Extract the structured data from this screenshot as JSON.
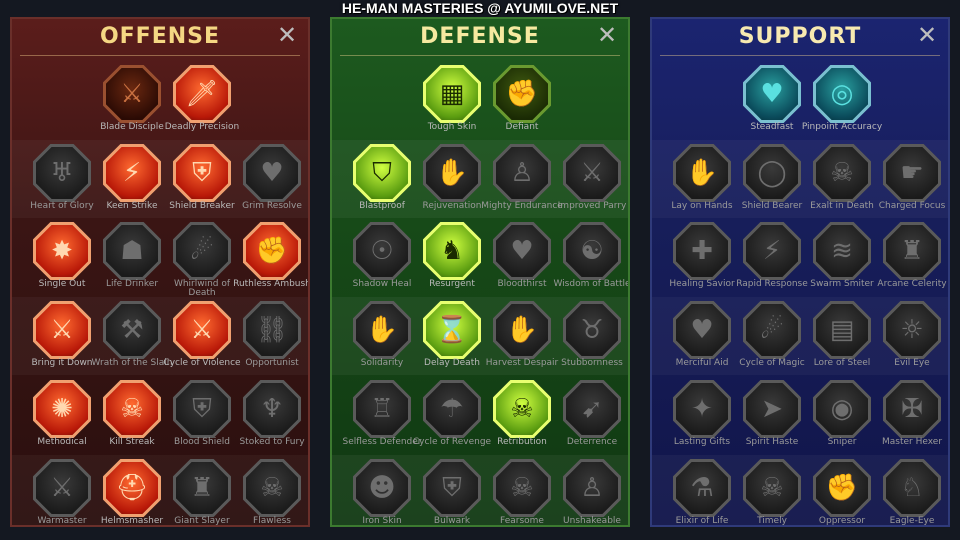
{
  "page_title": "HE-MAN MASTERIES @ AYUMILOVE.NET",
  "close_glyph": "✕",
  "panels": [
    {
      "id": "offense",
      "title": "OFFENSE",
      "skills": [
        {
          "label": "Blade Disciple",
          "icon": "crossed-swords-icon",
          "glyph": "⚔",
          "state": "dim-active",
          "row": 0,
          "col": 1
        },
        {
          "label": "Deadly Precision",
          "icon": "dagger-icon",
          "glyph": "🗡",
          "state": "active",
          "row": 0,
          "col": 2
        },
        {
          "label": "Heart of Glory",
          "icon": "horned-warrior-icon",
          "glyph": "♅",
          "state": "locked",
          "row": 1,
          "col": 0
        },
        {
          "label": "Keen Strike",
          "icon": "slash-icon",
          "glyph": "⚡",
          "state": "active",
          "row": 1,
          "col": 1
        },
        {
          "label": "Shield Breaker",
          "icon": "broken-shield-icon",
          "glyph": "⛨",
          "state": "active",
          "row": 1,
          "col": 2
        },
        {
          "label": "Grim Resolve",
          "icon": "heart-thorns-icon",
          "glyph": "♥",
          "state": "locked",
          "row": 1,
          "col": 3
        },
        {
          "label": "Single Out",
          "icon": "target-hit-icon",
          "glyph": "✸",
          "state": "active",
          "row": 2,
          "col": 0
        },
        {
          "label": "Life Drinker",
          "icon": "fangs-icon",
          "glyph": "☗",
          "state": "locked",
          "row": 2,
          "col": 1
        },
        {
          "label": "Whirlwind of Death",
          "icon": "whirlwind-icon",
          "glyph": "☄",
          "state": "locked",
          "row": 2,
          "col": 2
        },
        {
          "label": "Ruthless Ambush",
          "icon": "fist-blade-icon",
          "glyph": "✊",
          "state": "active",
          "row": 2,
          "col": 3
        },
        {
          "label": "Bring it Down",
          "icon": "falling-sword-icon",
          "glyph": "⚔",
          "state": "active",
          "row": 3,
          "col": 0
        },
        {
          "label": "Wrath of the Slain",
          "icon": "hammer-fist-icon",
          "glyph": "⚒",
          "state": "locked",
          "row": 3,
          "col": 1
        },
        {
          "label": "Cycle of Violence",
          "icon": "axe-icon",
          "glyph": "⚔",
          "state": "active",
          "row": 3,
          "col": 2
        },
        {
          "label": "Opportunist",
          "icon": "chain-lightning-icon",
          "glyph": "⛓",
          "state": "locked",
          "row": 3,
          "col": 3
        },
        {
          "label": "Methodical",
          "icon": "burst-circle-icon",
          "glyph": "✺",
          "state": "active",
          "row": 4,
          "col": 0
        },
        {
          "label": "Kill Streak",
          "icon": "skull-icon",
          "glyph": "☠",
          "state": "active",
          "row": 4,
          "col": 1
        },
        {
          "label": "Blood Shield",
          "icon": "sword-shield-icon",
          "glyph": "⛨",
          "state": "locked",
          "row": 4,
          "col": 2
        },
        {
          "label": "Stoked to Fury",
          "icon": "rage-figure-icon",
          "glyph": "♆",
          "state": "locked",
          "row": 4,
          "col": 3
        },
        {
          "label": "Warmaster",
          "icon": "warrior-sword-icon",
          "glyph": "⚔",
          "state": "locked",
          "row": 5,
          "col": 0
        },
        {
          "label": "Helmsmasher",
          "icon": "helmet-icon",
          "glyph": "⛑",
          "state": "active",
          "row": 5,
          "col": 1
        },
        {
          "label": "Giant Slayer",
          "icon": "giant-icon",
          "glyph": "♜",
          "state": "locked",
          "row": 5,
          "col": 2
        },
        {
          "label": "Flawless Execution",
          "icon": "skull-blade-icon",
          "glyph": "☠",
          "state": "locked",
          "row": 5,
          "col": 3
        }
      ]
    },
    {
      "id": "defense",
      "title": "DEFENSE",
      "skills": [
        {
          "label": "Tough Skin",
          "icon": "armor-plates-icon",
          "glyph": "▦",
          "state": "active",
          "row": 0,
          "col": 1
        },
        {
          "label": "Defiant",
          "icon": "raised-fist-icon",
          "glyph": "✊",
          "state": "dim-active",
          "row": 0,
          "col": 2
        },
        {
          "label": "Blastproof",
          "icon": "chevron-shield-icon",
          "glyph": "⛉",
          "state": "active",
          "row": 1,
          "col": 0
        },
        {
          "label": "Rejuvenation",
          "icon": "hand-heart-icon",
          "glyph": "✋",
          "state": "locked",
          "row": 1,
          "col": 1
        },
        {
          "label": "Mighty Endurance",
          "icon": "muscle-figure-icon",
          "glyph": "♙",
          "state": "locked",
          "row": 1,
          "col": 2
        },
        {
          "label": "Improved Parry",
          "icon": "parry-blades-icon",
          "glyph": "⚔",
          "state": "locked",
          "row": 1,
          "col": 3
        },
        {
          "label": "Shadow Heal",
          "icon": "shadow-figure-icon",
          "glyph": "☉",
          "state": "locked",
          "row": 2,
          "col": 0
        },
        {
          "label": "Resurgent",
          "icon": "knight-shield-icon",
          "glyph": "♞",
          "state": "active",
          "row": 2,
          "col": 1
        },
        {
          "label": "Bloodthirst",
          "icon": "skull-heart-icon",
          "glyph": "♥",
          "state": "locked",
          "row": 2,
          "col": 2
        },
        {
          "label": "Wisdom of Battle",
          "icon": "warrior-aura-icon",
          "glyph": "☯",
          "state": "locked",
          "row": 2,
          "col": 3
        },
        {
          "label": "Solidarity",
          "icon": "raised-hands-icon",
          "glyph": "✋",
          "state": "locked",
          "row": 3,
          "col": 0
        },
        {
          "label": "Delay Death",
          "icon": "hourglass-icon",
          "glyph": "⌛",
          "state": "active",
          "row": 3,
          "col": 1
        },
        {
          "label": "Harvest Despair",
          "icon": "open-hand-icon",
          "glyph": "✋",
          "state": "locked",
          "row": 3,
          "col": 2
        },
        {
          "label": "Stubbornness",
          "icon": "bull-head-icon",
          "glyph": "♉",
          "state": "locked",
          "row": 3,
          "col": 3
        },
        {
          "label": "Selfless Defender",
          "icon": "defender-figure-icon",
          "glyph": "♖",
          "state": "locked",
          "row": 4,
          "col": 0
        },
        {
          "label": "Cycle of Revenge",
          "icon": "drops-icon",
          "glyph": "☂",
          "state": "locked",
          "row": 4,
          "col": 1
        },
        {
          "label": "Retribution",
          "icon": "skull-burst-icon",
          "glyph": "☠",
          "state": "active",
          "row": 4,
          "col": 2
        },
        {
          "label": "Deterrence",
          "icon": "deflect-icon",
          "glyph": "➹",
          "state": "locked",
          "row": 4,
          "col": 3
        },
        {
          "label": "Iron Skin",
          "icon": "iron-face-icon",
          "glyph": "☻",
          "state": "locked",
          "row": 5,
          "col": 0
        },
        {
          "label": "Bulwark",
          "icon": "bulwark-shield-icon",
          "glyph": "⛨",
          "state": "locked",
          "row": 5,
          "col": 1
        },
        {
          "label": "Fearsome Presence",
          "icon": "demon-face-icon",
          "glyph": "☠",
          "state": "locked",
          "row": 5,
          "col": 2
        },
        {
          "label": "Unshakeable",
          "icon": "flexing-figure-icon",
          "glyph": "♙",
          "state": "locked",
          "row": 5,
          "col": 3
        }
      ]
    },
    {
      "id": "support",
      "title": "SUPPORT",
      "skills": [
        {
          "label": "Steadfast",
          "icon": "heart-hands-icon",
          "glyph": "♥",
          "state": "active",
          "row": 0,
          "col": 1
        },
        {
          "label": "Pinpoint Accuracy",
          "icon": "swirl-target-icon",
          "glyph": "◎",
          "state": "active",
          "row": 0,
          "col": 2
        },
        {
          "label": "Lay on Hands",
          "icon": "praying-hands-icon",
          "glyph": "✋",
          "state": "locked",
          "row": 1,
          "col": 0
        },
        {
          "label": "Shield Bearer",
          "icon": "round-shield-icon",
          "glyph": "◯",
          "state": "locked",
          "row": 1,
          "col": 1
        },
        {
          "label": "Exalt in Death",
          "icon": "burning-skull-icon",
          "glyph": "☠",
          "state": "locked",
          "row": 1,
          "col": 2
        },
        {
          "label": "Charged Focus",
          "icon": "charging-hand-icon",
          "glyph": "☛",
          "state": "locked",
          "row": 1,
          "col": 3
        },
        {
          "label": "Healing Savior",
          "icon": "healer-figure-icon",
          "glyph": "✚",
          "state": "locked",
          "row": 2,
          "col": 0
        },
        {
          "label": "Rapid Response",
          "icon": "lightning-shield-icon",
          "glyph": "⚡",
          "state": "locked",
          "row": 2,
          "col": 1
        },
        {
          "label": "Swarm Smiter",
          "icon": "swarm-icon",
          "glyph": "≋",
          "state": "locked",
          "row": 2,
          "col": 2
        },
        {
          "label": "Arcane Celerity",
          "icon": "running-figures-icon",
          "glyph": "♜",
          "state": "locked",
          "row": 2,
          "col": 3
        },
        {
          "label": "Merciful Aid",
          "icon": "chained-heart-icon",
          "glyph": "♥",
          "state": "locked",
          "row": 3,
          "col": 0
        },
        {
          "label": "Cycle of Magic",
          "icon": "comet-icon",
          "glyph": "☄",
          "state": "locked",
          "row": 3,
          "col": 1
        },
        {
          "label": "Lore of Steel",
          "icon": "open-book-icon",
          "glyph": "▤",
          "state": "locked",
          "row": 3,
          "col": 2
        },
        {
          "label": "Evil Eye",
          "icon": "eye-rays-icon",
          "glyph": "☼",
          "state": "locked",
          "row": 3,
          "col": 3
        },
        {
          "label": "Lasting Gifts",
          "icon": "compass-star-icon",
          "glyph": "✦",
          "state": "locked",
          "row": 4,
          "col": 0
        },
        {
          "label": "Spirit Haste",
          "icon": "boot-icon",
          "glyph": "➤",
          "state": "locked",
          "row": 4,
          "col": 1
        },
        {
          "label": "Sniper",
          "icon": "eye-icon",
          "glyph": "◉",
          "state": "locked",
          "row": 4,
          "col": 2
        },
        {
          "label": "Master Hexer",
          "icon": "hexer-figure-icon",
          "glyph": "✠",
          "state": "locked",
          "row": 4,
          "col": 3
        },
        {
          "label": "Elixir of Life",
          "icon": "potion-flask-icon",
          "glyph": "⚗",
          "state": "locked",
          "row": 5,
          "col": 0
        },
        {
          "label": "Timely Intervention",
          "icon": "skull-icon",
          "glyph": "☠",
          "state": "locked",
          "row": 5,
          "col": 1
        },
        {
          "label": "Oppressor",
          "icon": "gripping-hand-icon",
          "glyph": "✊",
          "state": "locked",
          "row": 5,
          "col": 2
        },
        {
          "label": "Eagle-Eye",
          "icon": "eagle-head-icon",
          "glyph": "♘",
          "state": "locked",
          "row": 5,
          "col": 3
        }
      ]
    }
  ]
}
